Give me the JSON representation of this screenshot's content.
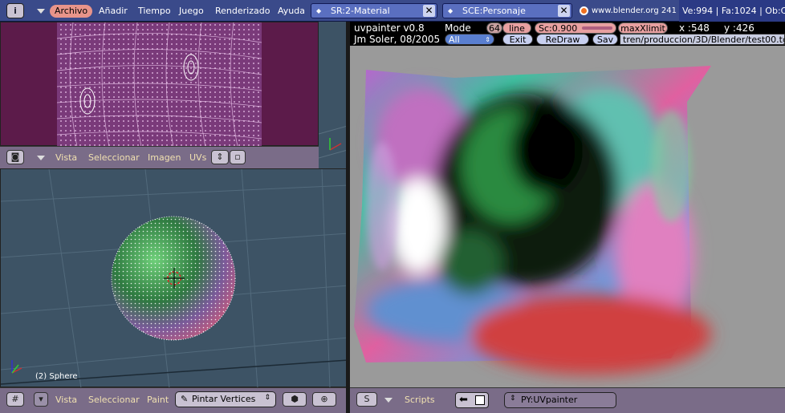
{
  "topbar": {
    "menus": [
      "Archivo",
      "Añadir",
      "Tiempo",
      "Juego",
      "Renderizado",
      "Ayuda"
    ],
    "screen_field": "SR:2-Material",
    "scene_field": "SCE:Personaje",
    "url": "www.blender.org 241",
    "stats": "Ve:994 | Fa:1024 | Ob:C"
  },
  "uv_editor": {
    "menus": [
      "Vista",
      "Seleccionar",
      "Imagen",
      "UVs"
    ]
  },
  "view3d": {
    "object_label": "(2) Sphere",
    "menus": [
      "Vista",
      "Seleccionar",
      "Paint"
    ],
    "mode_select": "Pintar Vertices"
  },
  "uvpainter": {
    "title": "uvpainter v0.8",
    "author": "Jm Soler, 08/2005",
    "mode_label": "Mode",
    "mode_value": "64",
    "line_button": "line",
    "scale": "Sc:0.900",
    "maxlimit_button": "maxXlimit",
    "x_coord": "x :548",
    "y_coord": "y :426",
    "select_all": "All",
    "exit_button": "Exit",
    "redraw_button": "ReDraw",
    "save_button": "Sav",
    "path": "tren/produccion/3D/Blender/test00.tg"
  },
  "script_window": {
    "menu": "Scripts",
    "script_name": "PY:UVpainter"
  },
  "colors": {
    "header": "#7a6c88",
    "topbar": "#3a4a8a",
    "uv_bg": "#5c1b4a",
    "view3d_bg": "#3d5365",
    "highlight": "#e8948a"
  }
}
